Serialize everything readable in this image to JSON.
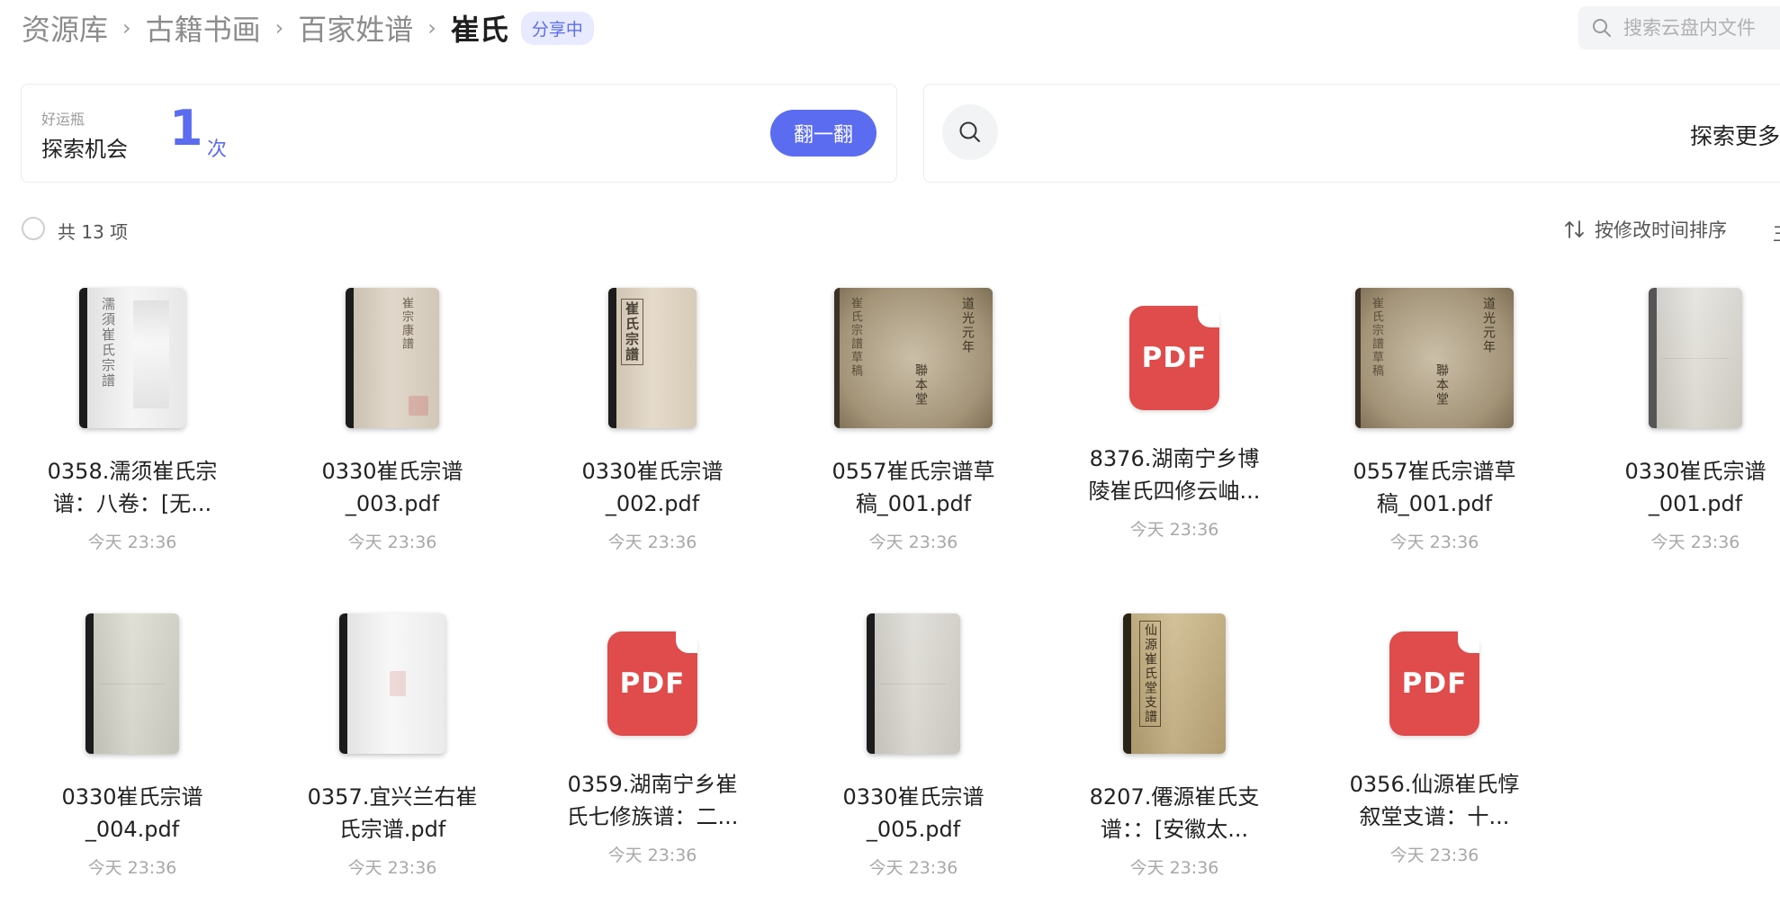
{
  "breadcrumb": {
    "items": [
      "资源库",
      "古籍书画",
      "百家姓谱"
    ],
    "separator": "›",
    "current": "崔氏",
    "badge": "分享中"
  },
  "search": {
    "placeholder": "搜索云盘内文件"
  },
  "lucky": {
    "small_label": "好运瓶",
    "title": "探索机会",
    "count": "1",
    "unit": "次",
    "button": "翻一翻"
  },
  "explore": {
    "label": "探索更多"
  },
  "toolbar": {
    "count_label": "共 13 项",
    "sort_label": "按修改时间排序",
    "edge_label": "王"
  },
  "colors": {
    "accent": "#5b6cf0",
    "pdf_red": "#e04b4b"
  },
  "files": [
    {
      "name1": "0358.濡须崔氏宗",
      "name2": "谱：八卷：[无...",
      "time": "今天 23:36",
      "thumb": "book-scan-white"
    },
    {
      "name1": "0330崔氏宗谱",
      "name2": "_003.pdf",
      "time": "今天 23:36",
      "thumb": "book-cover-plain"
    },
    {
      "name1": "0330崔氏宗谱",
      "name2": "_002.pdf",
      "time": "今天 23:36",
      "thumb": "book-cover-titled"
    },
    {
      "name1": "0557崔氏宗谱草",
      "name2": "稿_001.pdf",
      "time": "今天 23:36",
      "thumb": "book-cover-aged"
    },
    {
      "name1": "8376.湖南宁乡博",
      "name2": "陵崔氏四修云岫...",
      "time": "今天 23:36",
      "thumb": "pdf-icon",
      "icon_text": "PDF"
    },
    {
      "name1": "0557崔氏宗谱草",
      "name2": "稿_001.pdf",
      "time": "今天 23:36",
      "thumb": "book-cover-aged"
    },
    {
      "name1": "0330崔氏宗谱",
      "name2": "_001.pdf",
      "time": "今天 23:36",
      "thumb": "book-cover-faded"
    },
    {
      "name1": "0330崔氏宗谱",
      "name2": "_004.pdf",
      "time": "今天 23:36",
      "thumb": "book-cover-faded"
    },
    {
      "name1": "0357.宜兴兰右崔",
      "name2": "氏宗谱.pdf",
      "time": "今天 23:36",
      "thumb": "book-scan-white"
    },
    {
      "name1": "0359.湖南宁乡崔",
      "name2": "氏七修族谱：二...",
      "time": "今天 23:36",
      "thumb": "pdf-icon",
      "icon_text": "PDF"
    },
    {
      "name1": "0330崔氏宗谱",
      "name2": "_005.pdf",
      "time": "今天 23:36",
      "thumb": "book-cover-faded"
    },
    {
      "name1": "8207.僊源崔氏支",
      "name2": "谱：：[安徽太...",
      "time": "今天 23:36",
      "thumb": "book-cover-yellow"
    },
    {
      "name1": "0356.仙源崔氏惇",
      "name2": "叙堂支谱：十...",
      "time": "今天 23:36",
      "thumb": "pdf-icon",
      "icon_text": "PDF"
    }
  ]
}
